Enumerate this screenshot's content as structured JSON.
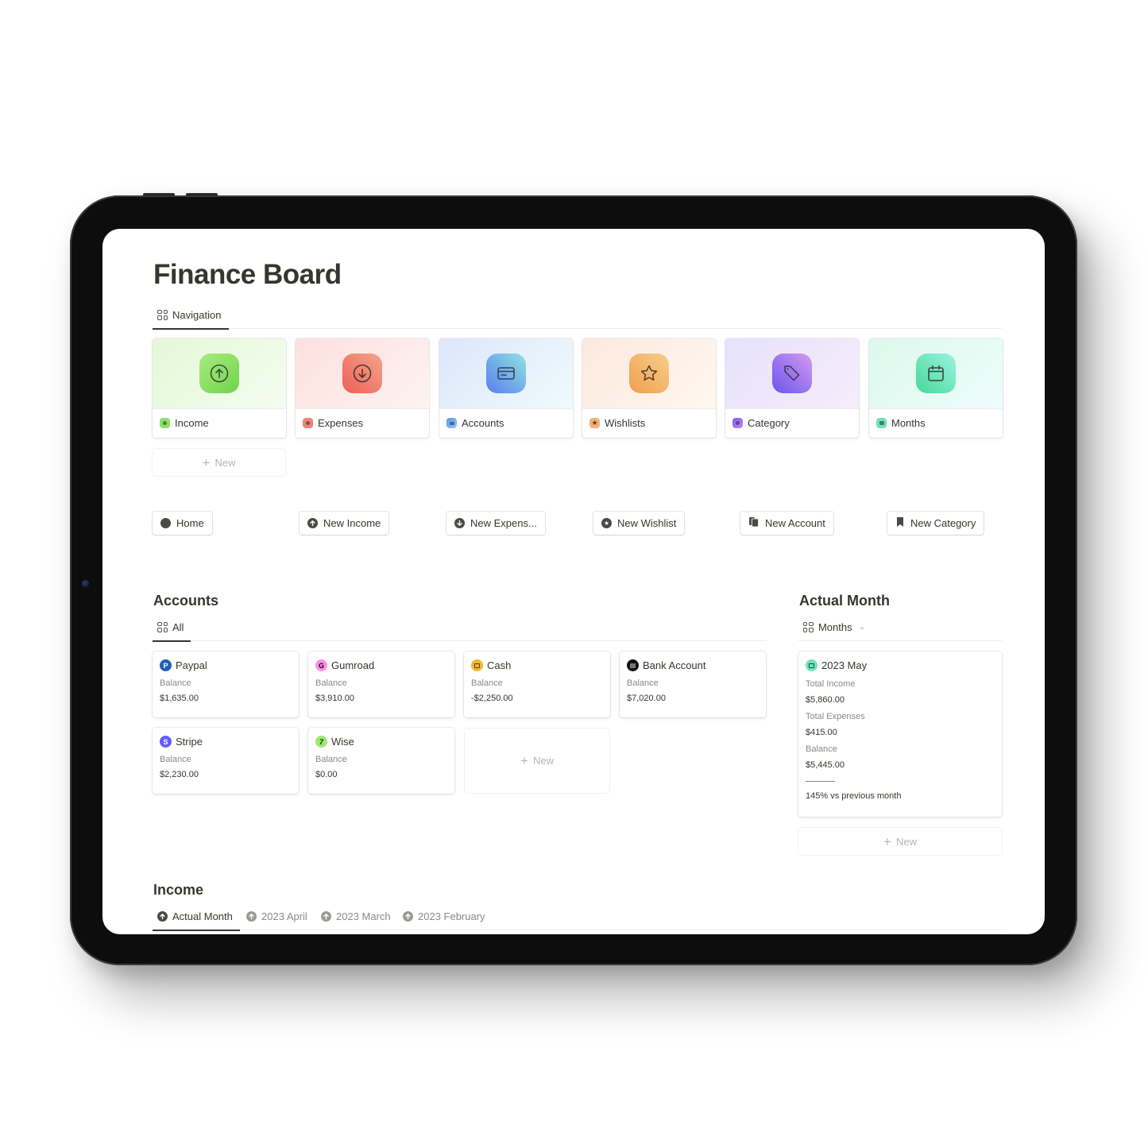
{
  "page": {
    "title": "Finance Board"
  },
  "navigation": {
    "tab_label": "Navigation",
    "cards": [
      {
        "label": "Income",
        "icon": "arrow-up-circle-icon",
        "color": "#7ed957"
      },
      {
        "label": "Expenses",
        "icon": "arrow-down-circle-icon",
        "color": "#ee6e63"
      },
      {
        "label": "Accounts",
        "icon": "credit-card-icon",
        "color": "#5b8ef0"
      },
      {
        "label": "Wishlists",
        "icon": "star-icon",
        "color": "#f2a95a"
      },
      {
        "label": "Category",
        "icon": "tag-icon",
        "color": "#8c63ee"
      },
      {
        "label": "Months",
        "icon": "calendar-icon",
        "color": "#4fe0b0"
      }
    ],
    "new_label": "New"
  },
  "actions": [
    {
      "label": "Home",
      "icon": "circle-icon"
    },
    {
      "label": "New Income",
      "icon": "arrow-up-circle-icon"
    },
    {
      "label": "New Expens...",
      "icon": "arrow-down-circle-icon"
    },
    {
      "label": "New Wishlist",
      "icon": "star-circle-icon"
    },
    {
      "label": "New Account",
      "icon": "cards-icon"
    },
    {
      "label": "New Category",
      "icon": "bookmark-icon"
    }
  ],
  "accounts": {
    "title": "Accounts",
    "tab_label": "All",
    "balance_label": "Balance",
    "items": [
      {
        "name": "Paypal",
        "balance": "$1,635.00",
        "icon": "paypal-icon",
        "color": "#1f5fb4"
      },
      {
        "name": "Gumroad",
        "balance": "$3,910.00",
        "icon": "gumroad-icon",
        "color": "#ff90e8"
      },
      {
        "name": "Cash",
        "balance": "-$2,250.00",
        "icon": "wallet-icon",
        "color": "#f2b630"
      },
      {
        "name": "Bank Account",
        "balance": "$7,020.00",
        "icon": "bank-icon",
        "color": "#111111"
      },
      {
        "name": "Stripe",
        "balance": "$2,230.00",
        "icon": "stripe-icon",
        "color": "#635bff"
      },
      {
        "name": "Wise",
        "balance": "$0.00",
        "icon": "wise-icon",
        "color": "#9fe870"
      }
    ],
    "new_label": "New"
  },
  "actual_month": {
    "title": "Actual Month",
    "view_label": "Months",
    "card": {
      "name": "2023 May",
      "total_income_label": "Total Income",
      "total_income": "$5,860.00",
      "total_expenses_label": "Total Expenses",
      "total_expenses": "$415.00",
      "balance_label": "Balance",
      "balance": "$5,445.00",
      "comparison": "145% vs previous month"
    },
    "new_label": "New"
  },
  "income": {
    "title": "Income",
    "tabs": [
      {
        "label": "Actual Month",
        "active": true
      },
      {
        "label": "2023 April",
        "active": false
      },
      {
        "label": "2023 March",
        "active": false
      },
      {
        "label": "2023 February",
        "active": false
      }
    ]
  }
}
